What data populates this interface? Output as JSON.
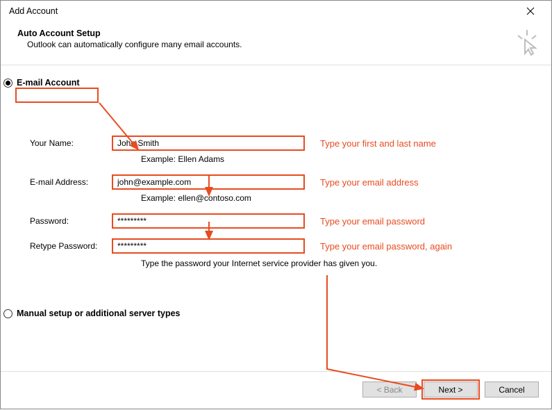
{
  "window": {
    "title": "Add Account"
  },
  "header": {
    "title": "Auto Account Setup",
    "subtitle": "Outlook can automatically configure many email accounts."
  },
  "radios": {
    "email_account": "E-mail Account",
    "manual": "Manual setup or additional server types"
  },
  "form": {
    "name_label": "Your Name:",
    "name_value": "John Smith",
    "name_example": "Example: Ellen Adams",
    "email_label": "E-mail Address:",
    "email_value": "john@example.com",
    "email_example": "Example: ellen@contoso.com",
    "password_label": "Password:",
    "password_value": "*********",
    "retype_label": "Retype Password:",
    "retype_value": "*********",
    "password_note": "Type the password your Internet service provider has given you."
  },
  "annotations": {
    "name": "Type your first and last name",
    "email": "Type your email address",
    "password": "Type your email password",
    "retype": "Type your email password, again"
  },
  "buttons": {
    "back": "< Back",
    "next": "Next >",
    "cancel": "Cancel"
  }
}
